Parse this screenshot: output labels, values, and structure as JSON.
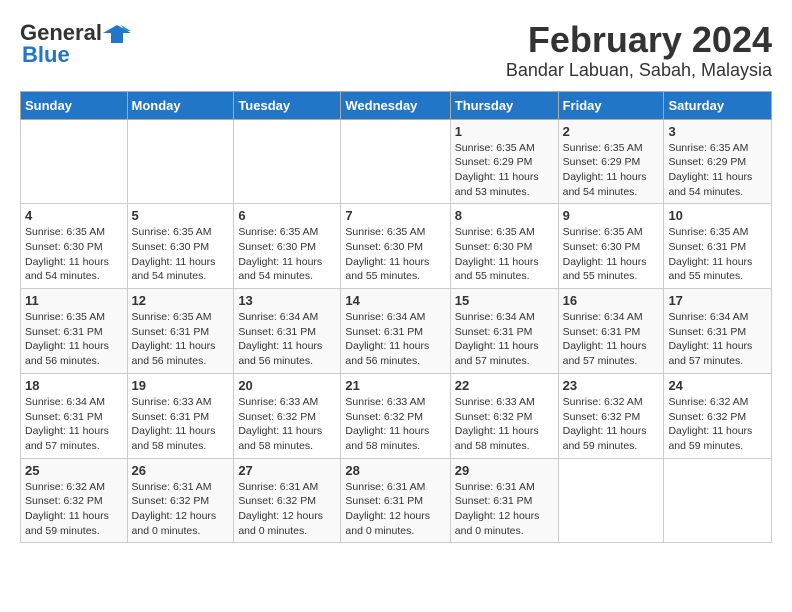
{
  "header": {
    "logo_general": "General",
    "logo_blue": "Blue",
    "title": "February 2024",
    "subtitle": "Bandar Labuan, Sabah, Malaysia"
  },
  "days_of_week": [
    "Sunday",
    "Monday",
    "Tuesday",
    "Wednesday",
    "Thursday",
    "Friday",
    "Saturday"
  ],
  "weeks": [
    [
      {
        "day": "",
        "info": ""
      },
      {
        "day": "",
        "info": ""
      },
      {
        "day": "",
        "info": ""
      },
      {
        "day": "",
        "info": ""
      },
      {
        "day": "1",
        "info": "Sunrise: 6:35 AM\nSunset: 6:29 PM\nDaylight: 11 hours\nand 53 minutes."
      },
      {
        "day": "2",
        "info": "Sunrise: 6:35 AM\nSunset: 6:29 PM\nDaylight: 11 hours\nand 54 minutes."
      },
      {
        "day": "3",
        "info": "Sunrise: 6:35 AM\nSunset: 6:29 PM\nDaylight: 11 hours\nand 54 minutes."
      }
    ],
    [
      {
        "day": "4",
        "info": "Sunrise: 6:35 AM\nSunset: 6:30 PM\nDaylight: 11 hours\nand 54 minutes."
      },
      {
        "day": "5",
        "info": "Sunrise: 6:35 AM\nSunset: 6:30 PM\nDaylight: 11 hours\nand 54 minutes."
      },
      {
        "day": "6",
        "info": "Sunrise: 6:35 AM\nSunset: 6:30 PM\nDaylight: 11 hours\nand 54 minutes."
      },
      {
        "day": "7",
        "info": "Sunrise: 6:35 AM\nSunset: 6:30 PM\nDaylight: 11 hours\nand 55 minutes."
      },
      {
        "day": "8",
        "info": "Sunrise: 6:35 AM\nSunset: 6:30 PM\nDaylight: 11 hours\nand 55 minutes."
      },
      {
        "day": "9",
        "info": "Sunrise: 6:35 AM\nSunset: 6:30 PM\nDaylight: 11 hours\nand 55 minutes."
      },
      {
        "day": "10",
        "info": "Sunrise: 6:35 AM\nSunset: 6:31 PM\nDaylight: 11 hours\nand 55 minutes."
      }
    ],
    [
      {
        "day": "11",
        "info": "Sunrise: 6:35 AM\nSunset: 6:31 PM\nDaylight: 11 hours\nand 56 minutes."
      },
      {
        "day": "12",
        "info": "Sunrise: 6:35 AM\nSunset: 6:31 PM\nDaylight: 11 hours\nand 56 minutes."
      },
      {
        "day": "13",
        "info": "Sunrise: 6:34 AM\nSunset: 6:31 PM\nDaylight: 11 hours\nand 56 minutes."
      },
      {
        "day": "14",
        "info": "Sunrise: 6:34 AM\nSunset: 6:31 PM\nDaylight: 11 hours\nand 56 minutes."
      },
      {
        "day": "15",
        "info": "Sunrise: 6:34 AM\nSunset: 6:31 PM\nDaylight: 11 hours\nand 57 minutes."
      },
      {
        "day": "16",
        "info": "Sunrise: 6:34 AM\nSunset: 6:31 PM\nDaylight: 11 hours\nand 57 minutes."
      },
      {
        "day": "17",
        "info": "Sunrise: 6:34 AM\nSunset: 6:31 PM\nDaylight: 11 hours\nand 57 minutes."
      }
    ],
    [
      {
        "day": "18",
        "info": "Sunrise: 6:34 AM\nSunset: 6:31 PM\nDaylight: 11 hours\nand 57 minutes."
      },
      {
        "day": "19",
        "info": "Sunrise: 6:33 AM\nSunset: 6:31 PM\nDaylight: 11 hours\nand 58 minutes."
      },
      {
        "day": "20",
        "info": "Sunrise: 6:33 AM\nSunset: 6:32 PM\nDaylight: 11 hours\nand 58 minutes."
      },
      {
        "day": "21",
        "info": "Sunrise: 6:33 AM\nSunset: 6:32 PM\nDaylight: 11 hours\nand 58 minutes."
      },
      {
        "day": "22",
        "info": "Sunrise: 6:33 AM\nSunset: 6:32 PM\nDaylight: 11 hours\nand 58 minutes."
      },
      {
        "day": "23",
        "info": "Sunrise: 6:32 AM\nSunset: 6:32 PM\nDaylight: 11 hours\nand 59 minutes."
      },
      {
        "day": "24",
        "info": "Sunrise: 6:32 AM\nSunset: 6:32 PM\nDaylight: 11 hours\nand 59 minutes."
      }
    ],
    [
      {
        "day": "25",
        "info": "Sunrise: 6:32 AM\nSunset: 6:32 PM\nDaylight: 11 hours\nand 59 minutes."
      },
      {
        "day": "26",
        "info": "Sunrise: 6:31 AM\nSunset: 6:32 PM\nDaylight: 12 hours\nand 0 minutes."
      },
      {
        "day": "27",
        "info": "Sunrise: 6:31 AM\nSunset: 6:32 PM\nDaylight: 12 hours\nand 0 minutes."
      },
      {
        "day": "28",
        "info": "Sunrise: 6:31 AM\nSunset: 6:31 PM\nDaylight: 12 hours\nand 0 minutes."
      },
      {
        "day": "29",
        "info": "Sunrise: 6:31 AM\nSunset: 6:31 PM\nDaylight: 12 hours\nand 0 minutes."
      },
      {
        "day": "",
        "info": ""
      },
      {
        "day": "",
        "info": ""
      }
    ]
  ]
}
